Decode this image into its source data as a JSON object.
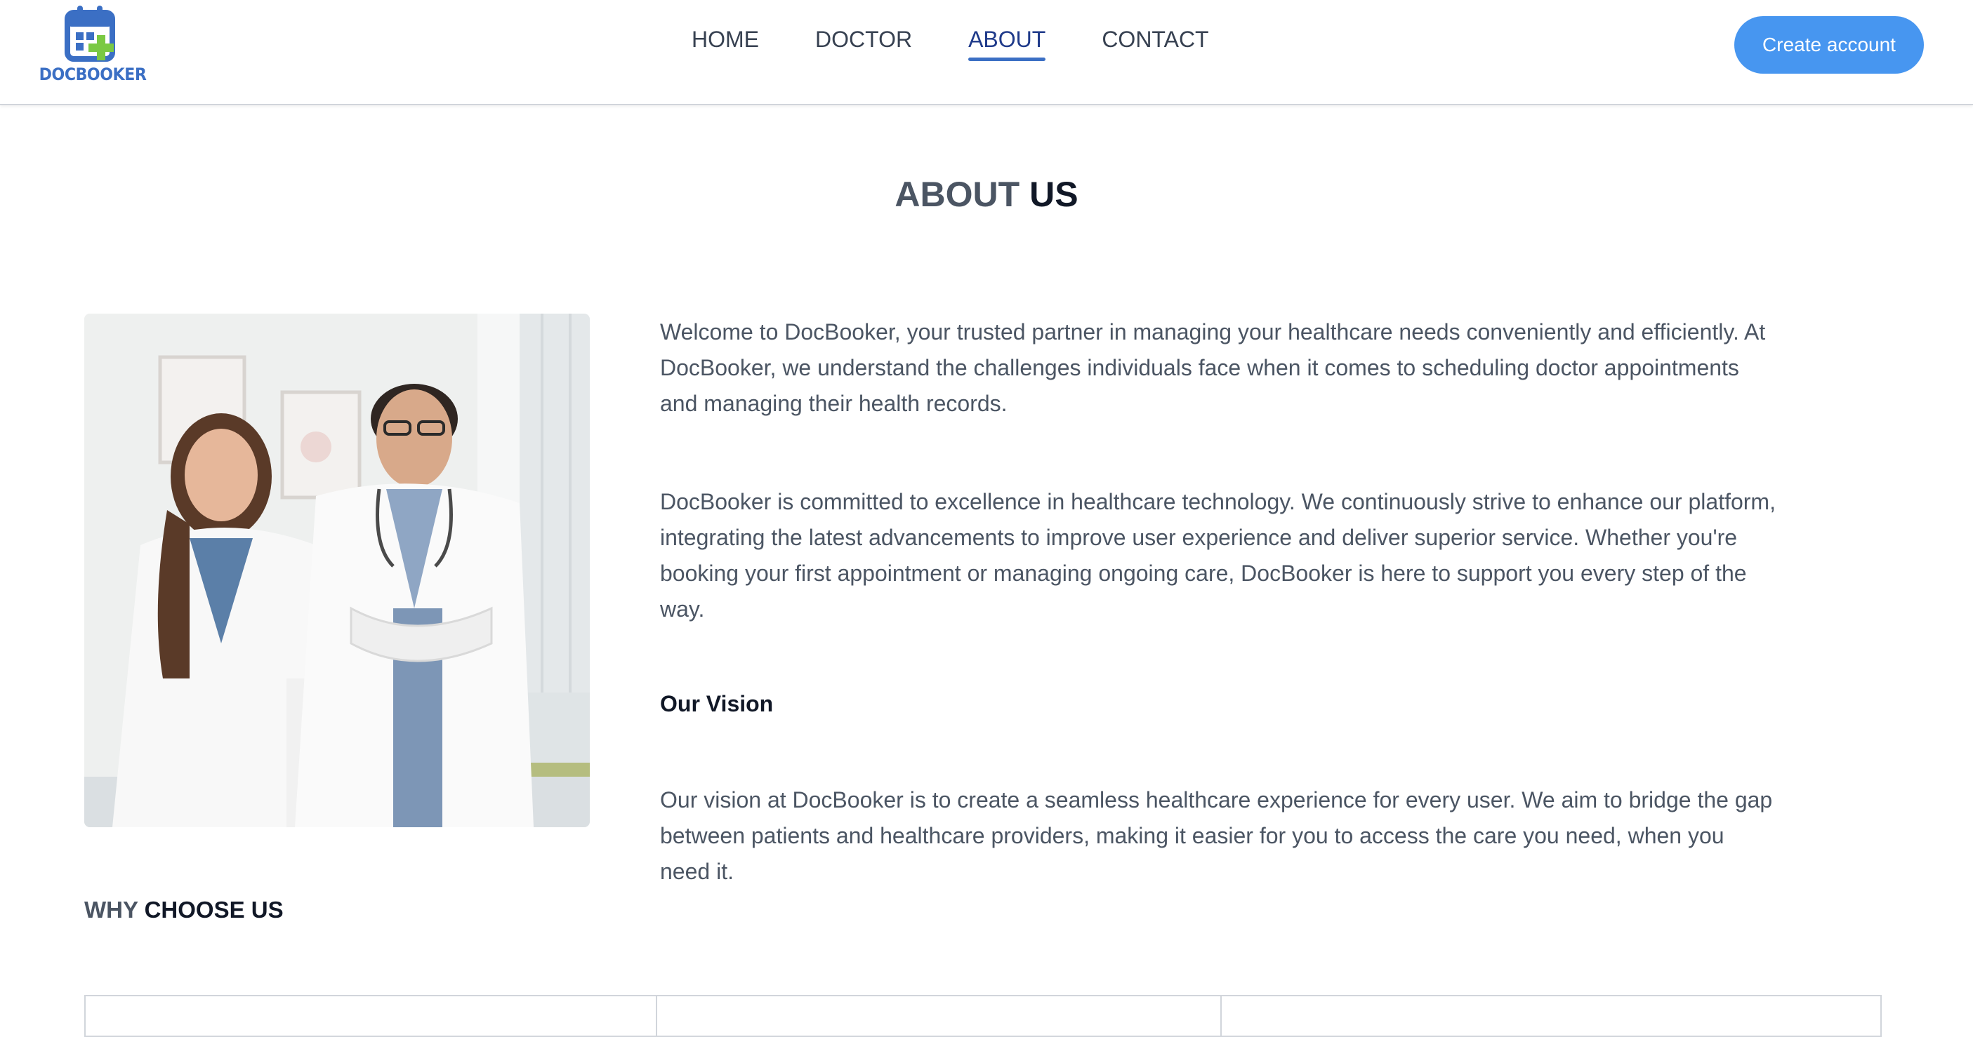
{
  "brand": {
    "name": "DOCBOOKER",
    "icon": "calendar-plus-icon",
    "colors": {
      "primary": "#3b6fc4",
      "accent": "#7ac943"
    }
  },
  "nav": {
    "items": [
      {
        "label": "HOME",
        "active": false
      },
      {
        "label": "DOCTOR",
        "active": false
      },
      {
        "label": "ABOUT",
        "active": true
      },
      {
        "label": "CONTACT",
        "active": false
      }
    ],
    "cta_label": "Create account",
    "cta_color": "#4796f0"
  },
  "about": {
    "title_prefix": "ABOUT",
    "title_strong": "US",
    "image_alt": "doctors-photo",
    "paragraph_1": "Welcome to DocBooker, your trusted partner in managing your healthcare needs conveniently and efficiently. At DocBooker, we understand the challenges individuals face when it comes to scheduling doctor appointments and managing their health records.",
    "paragraph_2": "DocBooker is committed to excellence in healthcare technology. We continuously strive to enhance our platform, integrating the latest advancements to improve user experience and deliver superior service. Whether you're booking your first appointment or managing ongoing care, DocBooker is here to support you every step of the way.",
    "vision_title": "Our Vision",
    "vision_text": "Our vision at DocBooker is to create a seamless healthcare experience for every user. We aim to bridge the gap between patients and healthcare providers, making it easier for you to access the care you need, when you need it."
  },
  "why": {
    "title_prefix": "WHY",
    "title_strong": "CHOOSE US"
  }
}
